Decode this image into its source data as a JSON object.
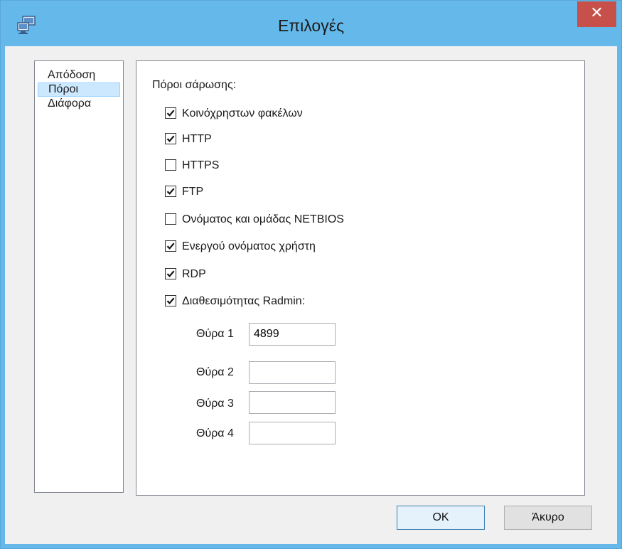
{
  "window": {
    "title": "Επιλογές",
    "close_symbol": "✕",
    "accent_color": "#64b9ea",
    "close_color": "#c7504a",
    "icon": "network-scanner-icon"
  },
  "nav": {
    "items": [
      {
        "label": "Απόδοση",
        "selected": false
      },
      {
        "label": "Πόροι",
        "selected": true
      },
      {
        "label": "Διάφορα",
        "selected": false
      }
    ]
  },
  "resources": {
    "section_label": "Πόροι σάρωσης:",
    "checkboxes": [
      {
        "label": "Κοινόχρηστων φακέλων",
        "checked": true
      },
      {
        "label": "HTTP",
        "checked": true
      },
      {
        "label": "HTTPS",
        "checked": false
      },
      {
        "label": "FTP",
        "checked": true
      },
      {
        "label": "Ονόματος και ομάδας NETBIOS",
        "checked": false
      },
      {
        "label": "Ενεργού ονόματος χρήστη",
        "checked": true
      },
      {
        "label": "RDP",
        "checked": true
      },
      {
        "label": "Διαθεσιμότητας Radmin:",
        "checked": true
      }
    ],
    "ports": [
      {
        "label": "Θύρα 1",
        "value": "4899"
      },
      {
        "label": "Θύρα 2",
        "value": ""
      },
      {
        "label": "Θύρα 3",
        "value": ""
      },
      {
        "label": "Θύρα 4",
        "value": ""
      }
    ]
  },
  "buttons": {
    "ok_label": "OK",
    "cancel_label": "Άκυρο"
  }
}
